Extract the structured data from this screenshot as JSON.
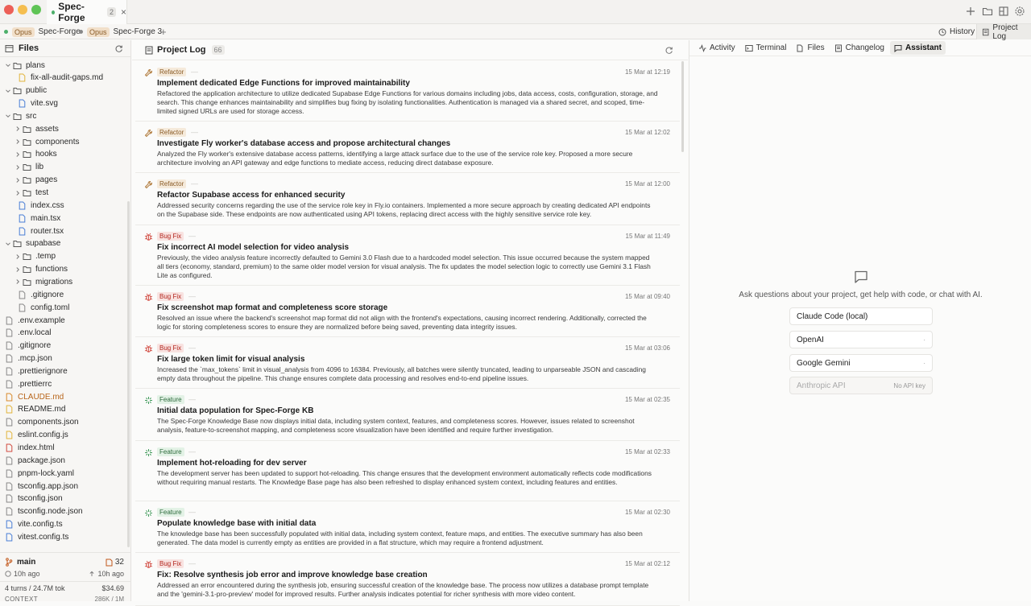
{
  "window": {
    "tab_title": "Spec-Forge",
    "tab_count": "2",
    "close": "×"
  },
  "subtabs": [
    {
      "model": "Opus",
      "name": "Spec-Forge"
    },
    {
      "model": "Opus",
      "name": "Spec-Forge 3"
    }
  ],
  "subtab_add": "+",
  "right_tabs": {
    "history": "History",
    "project_log": "Project Log"
  },
  "sidebar": {
    "title": "Files",
    "tree": [
      {
        "label": "plans",
        "type": "folder",
        "open": true,
        "depth": 0
      },
      {
        "label": "fix-all-audit-gaps.md",
        "type": "file",
        "color": "yellow",
        "depth": 2
      },
      {
        "label": "public",
        "type": "folder",
        "open": true,
        "depth": 0
      },
      {
        "label": "vite.svg",
        "type": "file",
        "color": "blue",
        "depth": 2
      },
      {
        "label": "src",
        "type": "folder",
        "open": true,
        "depth": 0
      },
      {
        "label": "assets",
        "type": "folder",
        "open": false,
        "depth": 1
      },
      {
        "label": "components",
        "type": "folder",
        "open": false,
        "depth": 1
      },
      {
        "label": "hooks",
        "type": "folder",
        "open": false,
        "depth": 1
      },
      {
        "label": "lib",
        "type": "folder",
        "open": false,
        "depth": 1
      },
      {
        "label": "pages",
        "type": "folder",
        "open": false,
        "depth": 1
      },
      {
        "label": "test",
        "type": "folder",
        "open": false,
        "depth": 1
      },
      {
        "label": "index.css",
        "type": "file",
        "color": "blue",
        "depth": 2
      },
      {
        "label": "main.tsx",
        "type": "file",
        "color": "blue",
        "depth": 2
      },
      {
        "label": "router.tsx",
        "type": "file",
        "color": "blue",
        "depth": 2
      },
      {
        "label": "supabase",
        "type": "folder",
        "open": true,
        "depth": 0
      },
      {
        "label": ".temp",
        "type": "folder",
        "open": false,
        "depth": 1
      },
      {
        "label": "functions",
        "type": "folder",
        "open": false,
        "depth": 1
      },
      {
        "label": "migrations",
        "type": "folder",
        "open": false,
        "depth": 1
      },
      {
        "label": ".gitignore",
        "type": "file",
        "color": "gray",
        "depth": 2
      },
      {
        "label": "config.toml",
        "type": "file",
        "color": "gray",
        "depth": 2
      },
      {
        "label": ".env.example",
        "type": "file",
        "color": "gray",
        "depth": 0
      },
      {
        "label": ".env.local",
        "type": "file",
        "color": "gray",
        "depth": 0
      },
      {
        "label": ".gitignore",
        "type": "file",
        "color": "gray",
        "depth": 0
      },
      {
        "label": ".mcp.json",
        "type": "file",
        "color": "gray",
        "depth": 0
      },
      {
        "label": ".prettierignore",
        "type": "file",
        "color": "gray",
        "depth": 0
      },
      {
        "label": ".prettierrc",
        "type": "file",
        "color": "gray",
        "depth": 0
      },
      {
        "label": "CLAUDE.md",
        "type": "file",
        "color": "orange",
        "depth": 0,
        "highlight": true
      },
      {
        "label": "README.md",
        "type": "file",
        "color": "yellow",
        "depth": 0
      },
      {
        "label": "components.json",
        "type": "file",
        "color": "gray",
        "depth": 0
      },
      {
        "label": "eslint.config.js",
        "type": "file",
        "color": "yellow",
        "depth": 0
      },
      {
        "label": "index.html",
        "type": "file",
        "color": "red",
        "depth": 0
      },
      {
        "label": "package.json",
        "type": "file",
        "color": "gray",
        "depth": 0
      },
      {
        "label": "pnpm-lock.yaml",
        "type": "file",
        "color": "gray",
        "depth": 0
      },
      {
        "label": "tsconfig.app.json",
        "type": "file",
        "color": "gray",
        "depth": 0
      },
      {
        "label": "tsconfig.json",
        "type": "file",
        "color": "gray",
        "depth": 0
      },
      {
        "label": "tsconfig.node.json",
        "type": "file",
        "color": "gray",
        "depth": 0
      },
      {
        "label": "vite.config.ts",
        "type": "file",
        "color": "blue",
        "depth": 0
      },
      {
        "label": "vitest.config.ts",
        "type": "file",
        "color": "blue",
        "depth": 0
      }
    ],
    "footer": {
      "branch": "main",
      "changes": "32",
      "time_left": "10h ago",
      "time_right": "10h ago",
      "turns": "4 turns / 24.7M tok",
      "cost": "$34.69",
      "context_label": "CONTEXT",
      "context_value": "286K / 1M"
    }
  },
  "log": {
    "title": "Project Log",
    "count": "66",
    "entries": [
      {
        "type": "refactor",
        "badge": "Refactor",
        "date": "15 Mar at 12:19",
        "title": "Implement dedicated Edge Functions for improved maintainability",
        "desc": "Refactored the application architecture to utilize dedicated Supabase Edge Functions for various domains including jobs, data access, costs, configuration, storage, and search. This change enhances maintainability and simplifies bug fixing by isolating functionalities. Authentication is managed via a shared secret, and scoped, time-limited signed URLs are used for storage access."
      },
      {
        "type": "refactor",
        "badge": "Refactor",
        "date": "15 Mar at 12:02",
        "title": "Investigate Fly worker's database access and propose architectural changes",
        "desc": "Analyzed the Fly worker's extensive database access patterns, identifying a large attack surface due to the use of the service role key. Proposed a more secure architecture involving an API gateway and edge functions to mediate access, reducing direct database exposure."
      },
      {
        "type": "refactor",
        "badge": "Refactor",
        "date": "15 Mar at 12:00",
        "title": "Refactor Supabase access for enhanced security",
        "desc": "Addressed security concerns regarding the use of the service role key in Fly.io containers. Implemented a more secure approach by creating dedicated API endpoints on the Supabase side. These endpoints are now authenticated using API tokens, replacing direct access with the highly sensitive service role key."
      },
      {
        "type": "bugfix",
        "badge": "Bug Fix",
        "date": "15 Mar at 11:49",
        "title": "Fix incorrect AI model selection for video analysis",
        "desc": "Previously, the video analysis feature incorrectly defaulted to Gemini 3.0 Flash due to a hardcoded model selection. This issue occurred because the system mapped all tiers (economy, standard, premium) to the same older model version for visual analysis. The fix updates the model selection logic to correctly use Gemini 3.1 Flash Lite as configured."
      },
      {
        "type": "bugfix",
        "badge": "Bug Fix",
        "date": "15 Mar at 09:40",
        "title": "Fix screenshot map format and completeness score storage",
        "desc": "Resolved an issue where the backend's screenshot map format did not align with the frontend's expectations, causing incorrect rendering. Additionally, corrected the logic for storing completeness scores to ensure they are normalized before being saved, preventing data integrity issues."
      },
      {
        "type": "bugfix",
        "badge": "Bug Fix",
        "date": "15 Mar at 03:06",
        "title": "Fix large token limit for visual analysis",
        "desc": "Increased the `max_tokens` limit in visual_analysis from 4096 to 16384. Previously, all batches were silently truncated, leading to unparseable JSON and cascading empty data throughout the pipeline. This change ensures complete data processing and resolves end-to-end pipeline issues."
      },
      {
        "type": "feature",
        "badge": "Feature",
        "date": "15 Mar at 02:35",
        "title": "Initial data population for Spec-Forge KB",
        "desc": "The Spec-Forge Knowledge Base now displays initial data, including system context, features, and completeness scores. However, issues related to screenshot analysis, feature-to-screenshot mapping, and completeness score visualization have been identified and require further investigation."
      },
      {
        "type": "feature",
        "badge": "Feature",
        "date": "15 Mar at 02:33",
        "title": "Implement hot-reloading for dev server",
        "desc": "The development server has been updated to support hot-reloading. This change ensures that the development environment automatically reflects code modifications without requiring manual restarts. The Knowledge Base page has also been refreshed to display enhanced system context, including features and entities."
      },
      {
        "type": "feature",
        "badge": "Feature",
        "date": "15 Mar at 02:30",
        "title": "Populate knowledge base with initial data",
        "desc": "The knowledge base has been successfully populated with initial data, including system context, feature maps, and entities. The executive summary has also been generated. The data model is currently empty as entities are provided in a flat structure, which may require a frontend adjustment."
      },
      {
        "type": "bugfix",
        "badge": "Bug Fix",
        "date": "15 Mar at 02:12",
        "title": "Fix: Resolve synthesis job error and improve knowledge base creation",
        "desc": "Addressed an error encountered during the synthesis job, ensuring successful creation of the knowledge base. The process now utilizes a database prompt template and the 'gemini-3.1-pro-preview' model for improved results. Further analysis indicates potential for richer synthesis with more video content."
      }
    ]
  },
  "panel": {
    "tabs": [
      "Activity",
      "Terminal",
      "Files",
      "Changelog",
      "Assistant"
    ],
    "selected": "Assistant",
    "prompt": "Ask questions about your project, get help with code, or chat with AI.",
    "providers": [
      {
        "name": "Claude Code (local)",
        "note": ""
      },
      {
        "name": "OpenAI",
        "note": "·"
      },
      {
        "name": "Google Gemini",
        "note": "·"
      },
      {
        "name": "Anthropic API",
        "note": "No API key",
        "disabled": true
      }
    ]
  },
  "colors": {
    "accent": "#4caf6a",
    "refactor": "#b07a3a",
    "bugfix": "#d0453b",
    "feature": "#3f9a5a"
  }
}
